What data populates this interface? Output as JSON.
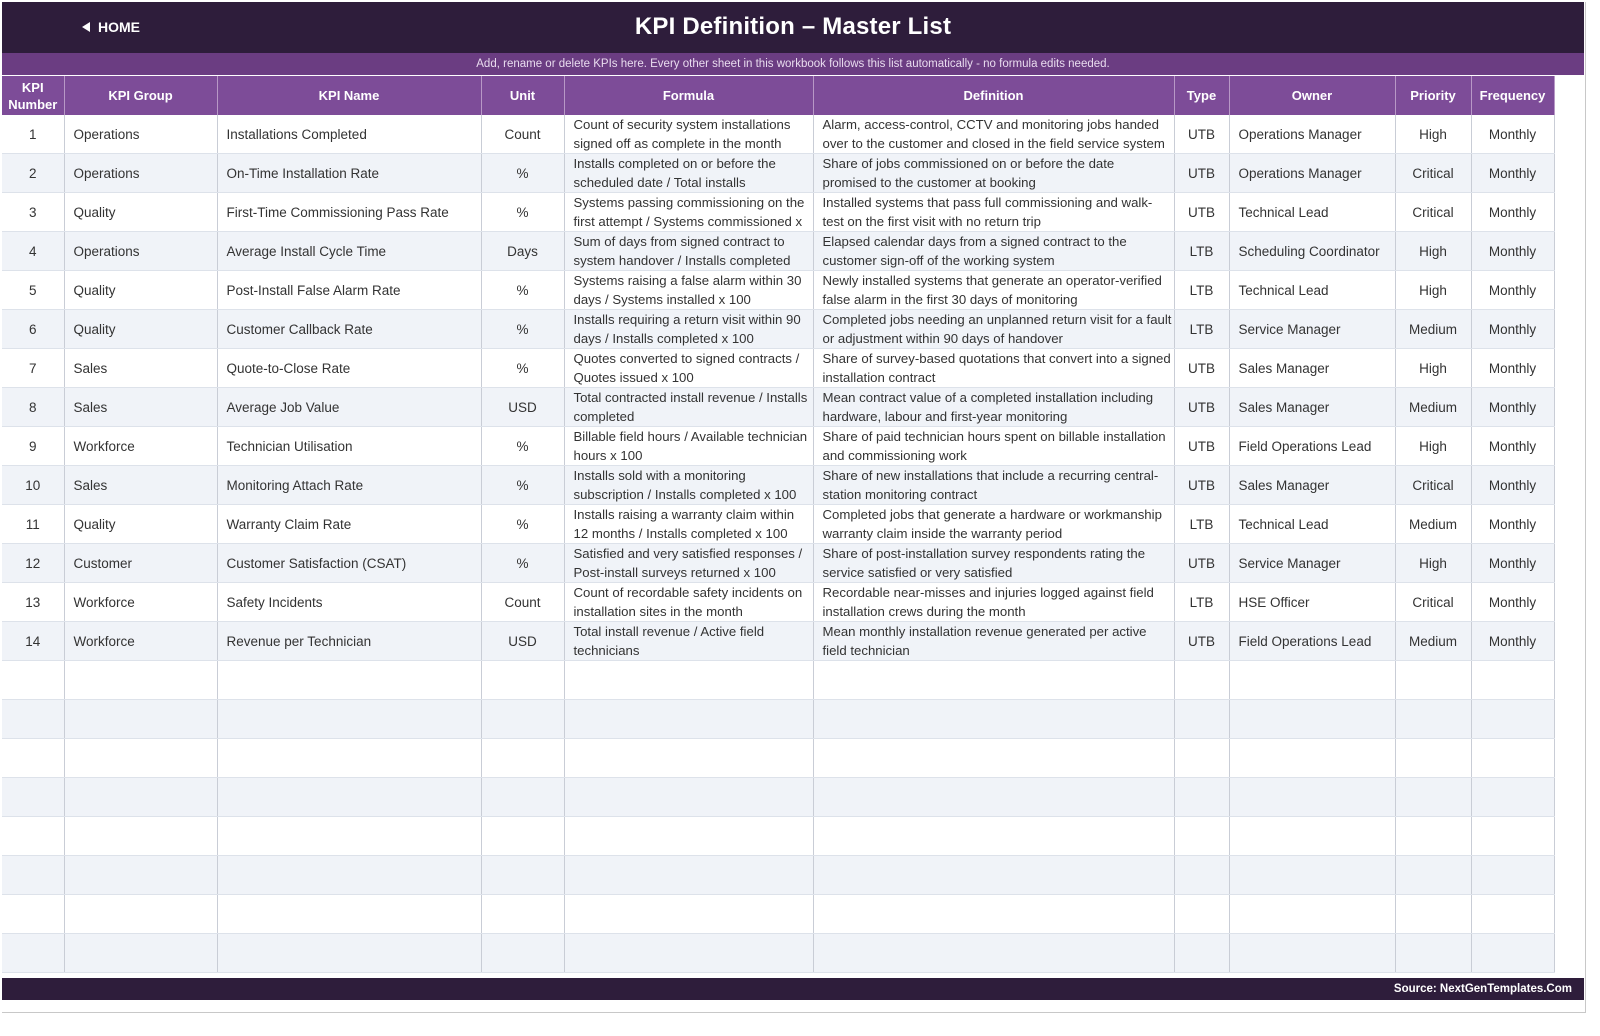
{
  "header": {
    "home_label": "HOME",
    "title": "KPI Definition  –  Master List",
    "subtitle": "Add, rename or delete KPIs here. Every other sheet in this workbook follows this list automatically - no formula edits needed."
  },
  "table": {
    "columns": [
      "KPI Number",
      "KPI Group",
      "KPI Name",
      "Unit",
      "Formula",
      "Definition",
      "Type",
      "Owner",
      "Priority",
      "Frequency"
    ],
    "rows": [
      [
        "1",
        "Operations",
        "Installations Completed",
        "Count",
        "Count of security system installations signed off as complete in the month",
        "Alarm, access-control, CCTV and monitoring jobs handed over to the customer and closed in the field service system",
        "UTB",
        "Operations Manager",
        "High",
        "Monthly"
      ],
      [
        "2",
        "Operations",
        "On-Time Installation Rate",
        "%",
        "Installs completed on or before the scheduled date / Total installs",
        "Share of jobs commissioned on or before the date promised to the customer at booking",
        "UTB",
        "Operations Manager",
        "Critical",
        "Monthly"
      ],
      [
        "3",
        "Quality",
        "First-Time Commissioning Pass Rate",
        "%",
        "Systems passing commissioning on the first attempt / Systems commissioned x",
        "Installed systems that pass full commissioning and walk-test on the first visit with no return trip",
        "UTB",
        "Technical Lead",
        "Critical",
        "Monthly"
      ],
      [
        "4",
        "Operations",
        "Average Install Cycle Time",
        "Days",
        "Sum of days from signed contract to system handover / Installs completed",
        "Elapsed calendar days from a signed contract to the customer sign-off of the working system",
        "LTB",
        "Scheduling Coordinator",
        "High",
        "Monthly"
      ],
      [
        "5",
        "Quality",
        "Post-Install False Alarm Rate",
        "%",
        "Systems raising a false alarm within 30 days / Systems installed x 100",
        "Newly installed systems that generate an operator-verified false alarm in the first 30 days of monitoring",
        "LTB",
        "Technical Lead",
        "High",
        "Monthly"
      ],
      [
        "6",
        "Quality",
        "Customer Callback Rate",
        "%",
        "Installs requiring a return visit within 90 days / Installs completed x 100",
        "Completed jobs needing an unplanned return visit for a fault or adjustment within 90 days of handover",
        "LTB",
        "Service Manager",
        "Medium",
        "Monthly"
      ],
      [
        "7",
        "Sales",
        "Quote-to-Close Rate",
        "%",
        "Quotes converted to signed contracts / Quotes issued x 100",
        "Share of survey-based quotations that convert into a signed installation contract",
        "UTB",
        "Sales Manager",
        "High",
        "Monthly"
      ],
      [
        "8",
        "Sales",
        "Average Job Value",
        "USD",
        "Total contracted install revenue / Installs completed",
        "Mean contract value of a completed installation including hardware, labour and first-year monitoring",
        "UTB",
        "Sales Manager",
        "Medium",
        "Monthly"
      ],
      [
        "9",
        "Workforce",
        "Technician Utilisation",
        "%",
        "Billable field hours / Available technician hours x 100",
        "Share of paid technician hours spent on billable installation and commissioning work",
        "UTB",
        "Field Operations Lead",
        "High",
        "Monthly"
      ],
      [
        "10",
        "Sales",
        "Monitoring Attach Rate",
        "%",
        "Installs sold with a monitoring subscription / Installs completed x 100",
        "Share of new installations that include a recurring central-station monitoring contract",
        "UTB",
        "Sales Manager",
        "Critical",
        "Monthly"
      ],
      [
        "11",
        "Quality",
        "Warranty Claim Rate",
        "%",
        "Installs raising a warranty claim within 12 months / Installs completed x 100",
        "Completed jobs that generate a hardware or workmanship warranty claim inside the warranty period",
        "LTB",
        "Technical Lead",
        "Medium",
        "Monthly"
      ],
      [
        "12",
        "Customer",
        "Customer Satisfaction (CSAT)",
        "%",
        "Satisfied and very satisfied responses / Post-install surveys returned x 100",
        "Share of post-installation survey respondents rating the service satisfied or very satisfied",
        "UTB",
        "Service Manager",
        "High",
        "Monthly"
      ],
      [
        "13",
        "Workforce",
        "Safety Incidents",
        "Count",
        "Count of recordable safety incidents on installation sites in the month",
        "Recordable near-misses and injuries logged against field installation crews during the month",
        "LTB",
        "HSE Officer",
        "Critical",
        "Monthly"
      ],
      [
        "14",
        "Workforce",
        "Revenue per Technician",
        "USD",
        "Total install revenue / Active field technicians",
        "Mean monthly installation revenue generated per active field technician",
        "UTB",
        "Field Operations Lead",
        "Medium",
        "Monthly"
      ]
    ],
    "empty_rows": 8
  },
  "footer": {
    "source": "Source: NextGenTemplates.Com"
  },
  "colors": {
    "title_bar": "#2e1d3b",
    "sub_bar": "#6b3d82",
    "header_row": "#7d4c98",
    "alt_row": "#f0f3f8"
  },
  "icons": {
    "home": "triangle-left-icon"
  }
}
